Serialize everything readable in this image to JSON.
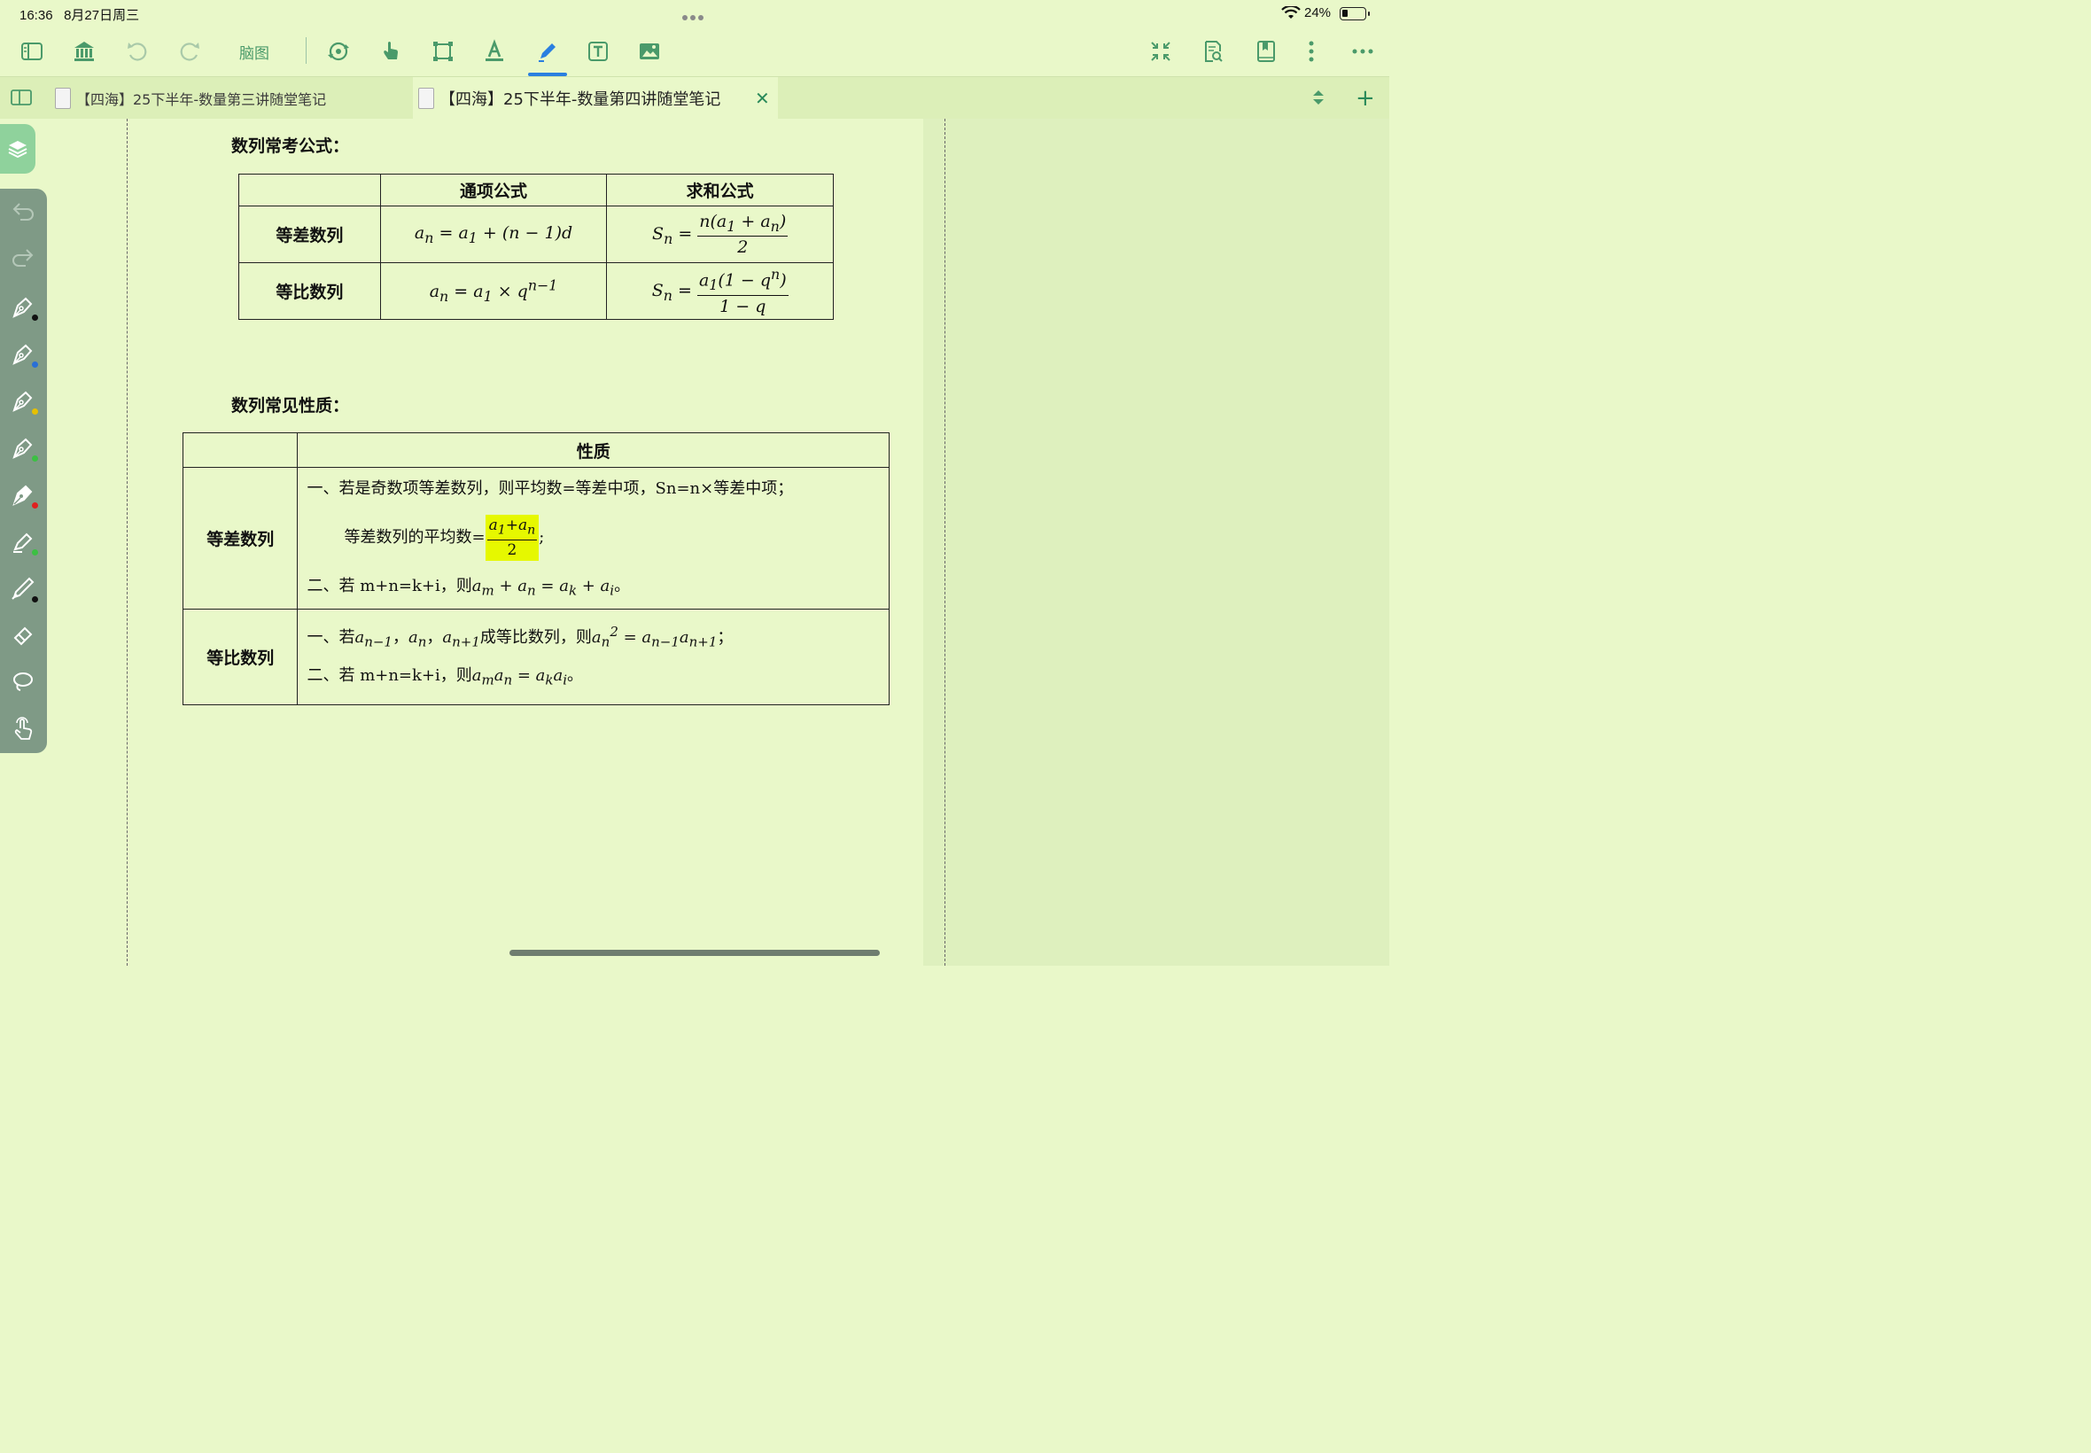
{
  "status_bar": {
    "time": "16:36",
    "date": "8月27日周三",
    "battery": "24%"
  },
  "toolbar": {
    "mindmap_label": "脑图",
    "icons": [
      "sidebar-icon",
      "library-icon",
      "undo-icon",
      "redo-icon",
      "sync-icon",
      "hand-icon",
      "crop-icon",
      "text-style-icon",
      "pen-icon",
      "text-box-icon",
      "image-icon",
      "collapse-icon",
      "search-doc-icon",
      "bookmark-icon",
      "more-vertical-icon",
      "more-horizontal-icon"
    ],
    "accent": "#4a9a6a",
    "active_accent": "#2a7fe0"
  },
  "tabs": [
    {
      "title": "【四海】25下半年-数量第三讲随堂笔记",
      "active": false
    },
    {
      "title": "【四海】25下半年-数量第四讲随堂笔记",
      "active": true
    }
  ],
  "document": {
    "section1_title": "数列常考公式：",
    "table1": {
      "headers": [
        "",
        "通项公式",
        "求和公式"
      ],
      "rows": [
        {
          "label": "等差数列",
          "general": "a_n = a_1 + (n − 1)d",
          "sum": "S_n = n(a_1 + a_n) / 2"
        },
        {
          "label": "等比数列",
          "general": "a_n = a_1 × q^(n−1)",
          "sum": "S_n = a_1(1 − q^n) / (1 − q)"
        }
      ]
    },
    "section2_title": "数列常见性质：",
    "table2": {
      "header": "性质",
      "arith_label": "等差数列",
      "geo_label": "等比数列",
      "arith_line1": "一、若是奇数项等差数列，则平均数=等差中项，Sn=n×等差中项；",
      "arith_line2_prefix": "等差数列的平均数=",
      "arith_line2_frac_num": "a1+an",
      "arith_line2_frac_den": "2",
      "arith_line3_prefix": "二、若 m+n=k+i，则",
      "geo_line1_prefix": "一、若",
      "geo_line1_middle": "成等比数列，则",
      "geo_line2_prefix": "二、若 m+n=k+i，则"
    }
  },
  "colors": {
    "page_bg": "#e9f8c9",
    "highlight": "#e6f800",
    "palette_bg": "#7f9a86"
  }
}
